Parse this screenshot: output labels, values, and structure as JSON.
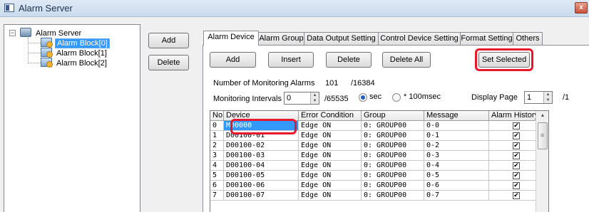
{
  "window": {
    "title": "Alarm Server",
    "close_glyph": "x"
  },
  "tree": {
    "root_label": "Alarm Server",
    "items": [
      {
        "label": "Alarm Block[0]",
        "selected": true
      },
      {
        "label": "Alarm Block[1]",
        "selected": false
      },
      {
        "label": "Alarm Block[2]",
        "selected": false
      }
    ]
  },
  "side_buttons": {
    "add": "Add",
    "delete": "Delete"
  },
  "tabs": [
    "Alarm Device",
    "Alarm Group",
    "Data Output Setting",
    "Control Device Setting",
    "Format Setting",
    "Others"
  ],
  "toolbar": {
    "add": "Add",
    "insert": "Insert",
    "delete": "Delete",
    "delete_all": "Delete All",
    "set_selected": "Set Selected"
  },
  "monitoring": {
    "count_label": "Number of Monitoring Alarms",
    "count_value": "101",
    "count_max": "/16384",
    "interval_label": "Monitoring Intervals",
    "interval_value": "0",
    "interval_max": "/65535",
    "unit_sec": "sec",
    "unit_100ms": "* 100msec",
    "display_page_label": "Display Page",
    "display_page_value": "1",
    "display_page_max": "/1"
  },
  "grid": {
    "columns": [
      "No.",
      "Device",
      "Error Condition",
      "Group",
      "Message",
      "Alarm History"
    ],
    "rows": [
      {
        "no": "0",
        "device": "M00000",
        "condition": "Edge  ON",
        "group": "0: GROUP00",
        "message": "0-0",
        "history": true
      },
      {
        "no": "1",
        "device": "D00100-01",
        "condition": "Edge  ON",
        "group": "0: GROUP00",
        "message": "0-1",
        "history": true
      },
      {
        "no": "2",
        "device": "D00100-02",
        "condition": "Edge  ON",
        "group": "0: GROUP00",
        "message": "0-2",
        "history": true
      },
      {
        "no": "3",
        "device": "D00100-03",
        "condition": "Edge  ON",
        "group": "0: GROUP00",
        "message": "0-3",
        "history": true
      },
      {
        "no": "4",
        "device": "D00100-04",
        "condition": "Edge  ON",
        "group": "0: GROUP00",
        "message": "0-4",
        "history": true
      },
      {
        "no": "5",
        "device": "D00100-05",
        "condition": "Edge  ON",
        "group": "0: GROUP00",
        "message": "0-5",
        "history": true
      },
      {
        "no": "6",
        "device": "D00100-06",
        "condition": "Edge  ON",
        "group": "0: GROUP00",
        "message": "0-6",
        "history": true
      },
      {
        "no": "7",
        "device": "D00100-07",
        "condition": "Edge  ON",
        "group": "0: GROUP00",
        "message": "0-7",
        "history": true
      }
    ]
  },
  "icons": {
    "checkbox": "✔",
    "spin_up": "▲",
    "spin_down": "▼",
    "scroll_up": "▲"
  },
  "colors": {
    "highlight": "#e8182c",
    "selection": "#3399ff"
  }
}
